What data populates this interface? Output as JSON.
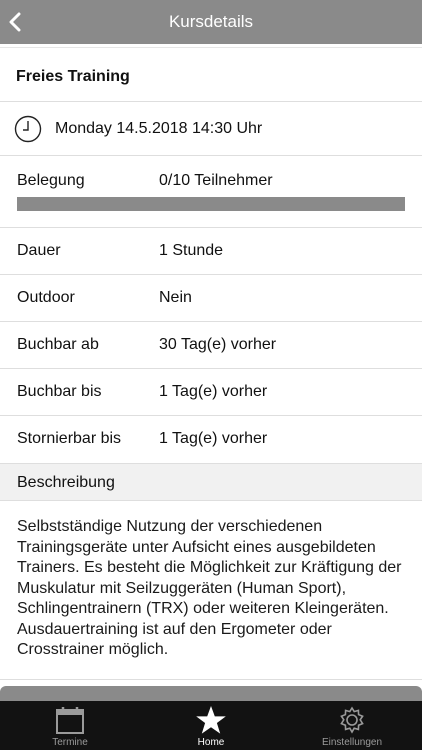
{
  "header": {
    "title": "Kursdetails"
  },
  "course": {
    "title": "Freies Training",
    "datetime": "Monday 14.5.2018 14:30 Uhr",
    "belegung": {
      "label": "Belegung",
      "value": "0/10 Teilnehmer",
      "fill_fraction": 0.0
    },
    "details": [
      {
        "label": "Dauer",
        "value": "1 Stunde"
      },
      {
        "label": "Outdoor",
        "value": "Nein"
      },
      {
        "label": "Buchbar ab",
        "value": "30 Tag(e) vorher"
      },
      {
        "label": "Buchbar bis",
        "value": "1 Tag(e) vorher"
      },
      {
        "label": "Stornierbar bis",
        "value": "1 Tag(e) vorher"
      }
    ],
    "description_header": "Beschreibung",
    "description": "Selbstständige Nutzung der verschiedenen Trainingsgeräte unter Aufsicht eines ausgebildeten Trainers. Es besteht die Möglichkeit zur Kräftigung der Muskulatur mit Seilzuggeräten (Human Sport), Schlingentrainern (TRX) oder weiteren Kleingeräten. Ausdauertraining ist auf den Ergometer oder Crosstrainer möglich."
  },
  "tabbar": {
    "tabs": [
      {
        "label": "Termine",
        "icon": "calendar-icon",
        "active": false
      },
      {
        "label": "Home",
        "icon": "star-icon",
        "active": true
      },
      {
        "label": "Einstellungen",
        "icon": "gear-icon",
        "active": false
      }
    ]
  },
  "colors": {
    "header_bg": "#8a8a8a",
    "tabbar_bg": "#121212",
    "section_bg": "#f1f1f1"
  }
}
